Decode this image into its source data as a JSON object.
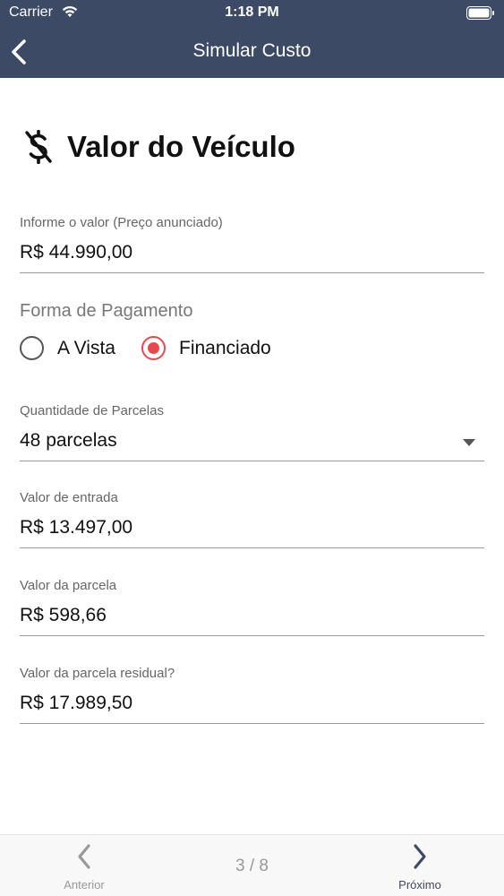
{
  "status": {
    "carrier": "Carrier",
    "time": "1:18 PM"
  },
  "nav": {
    "title": "Simular Custo"
  },
  "section": {
    "title": "Valor do Veículo"
  },
  "fields": {
    "price": {
      "label": "Informe o valor (Preço anunciado)",
      "value": "R$ 44.990,00"
    },
    "installments": {
      "label": "Quantidade de Parcelas",
      "value": "48 parcelas"
    },
    "down_payment": {
      "label": "Valor de entrada",
      "value": "R$ 13.497,00"
    },
    "installment_value": {
      "label": "Valor da parcela",
      "value": "R$ 598,66"
    },
    "residual": {
      "label": "Valor da parcela residual?",
      "value": "R$ 17.989,50"
    }
  },
  "payment": {
    "label": "Forma de Pagamento",
    "options": [
      {
        "label": "A Vista",
        "selected": false
      },
      {
        "label": "Financiado",
        "selected": true
      }
    ]
  },
  "bottom": {
    "prev_label": "Anterior",
    "next_label": "Próximo",
    "pager": "3 / 8"
  },
  "colors": {
    "header": "#3c4a66",
    "accent": "#e4494c"
  }
}
